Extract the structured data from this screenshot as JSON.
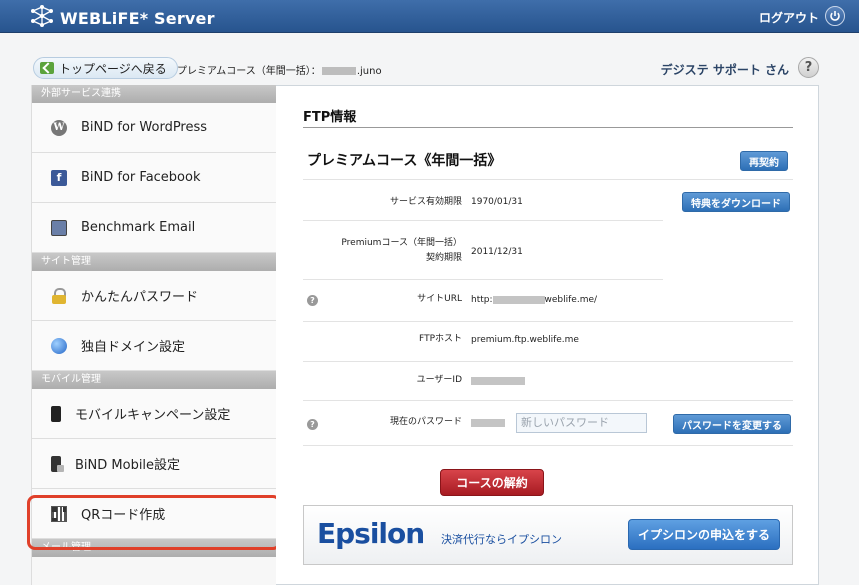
{
  "header": {
    "app_title": "WEBLiFE* Server",
    "logout_label": "ログアウト",
    "logo_icon": "network-logo-icon",
    "power_icon": "power-icon"
  },
  "breadcrumb": {
    "back_label": "トップページへ戻る",
    "course_prefix": "プレミアムコース（年間一括）：",
    "account_suffix": ".juno",
    "user_name": "デジステ サポート さん",
    "help_label": "?"
  },
  "sidebar": {
    "sections": [
      {
        "title": "外部サービス連携",
        "items": [
          {
            "label": "BiND for WordPress",
            "icon": "wordpress-icon"
          },
          {
            "label": "BiND for Facebook",
            "icon": "facebook-icon"
          },
          {
            "label": "Benchmark Email",
            "icon": "benchmark-email-icon"
          }
        ]
      },
      {
        "title": "サイト管理",
        "items": [
          {
            "label": "かんたんパスワード",
            "icon": "lock-icon"
          },
          {
            "label": "独自ドメイン設定",
            "icon": "globe-icon"
          }
        ]
      },
      {
        "title": "モバイル管理",
        "items": [
          {
            "label": "モバイルキャンペーン設定",
            "icon": "mobile-phone-icon"
          },
          {
            "label": "BiND Mobile設定",
            "icon": "bind-mobile-icon"
          },
          {
            "label": "QRコード作成",
            "icon": "qr-code-icon"
          }
        ]
      },
      {
        "title": "メール管理",
        "items": []
      }
    ],
    "highlight_color": "#e0402a"
  },
  "main": {
    "title": "FTP情報",
    "course_title": "プレミアムコース《年間一括》",
    "renew_label": "再契約",
    "fields": {
      "service_expiry_label": "サービス有効期限",
      "service_expiry_value": "1970/01/31",
      "download_label": "特典をダウンロード",
      "contract_label_1": "Premiumコース（年間一括）",
      "contract_label_2": "契約期限",
      "contract_value": "2011/12/31",
      "site_url_label": "サイトURL",
      "site_url_prefix": "http:",
      "site_url_suffix": "weblife.me/",
      "ftp_host_label": "FTPホスト",
      "ftp_host_value": "premium.ftp.weblife.me",
      "user_id_label": "ユーザーID",
      "current_pw_label": "現在のパスワード",
      "new_pw_placeholder": "新しいパスワード",
      "change_pw_label": "パスワードを変更する"
    },
    "cancel_label": "コースの解約",
    "epsilon": {
      "logo_text": "Epsilon",
      "tagline": "決済代行ならイプシロン",
      "apply_label": "イプシロンの申込をする"
    }
  },
  "colors": {
    "header_blue": "#2f5f9e",
    "button_blue": "#2d6fb6",
    "cancel_red": "#b9222a"
  }
}
